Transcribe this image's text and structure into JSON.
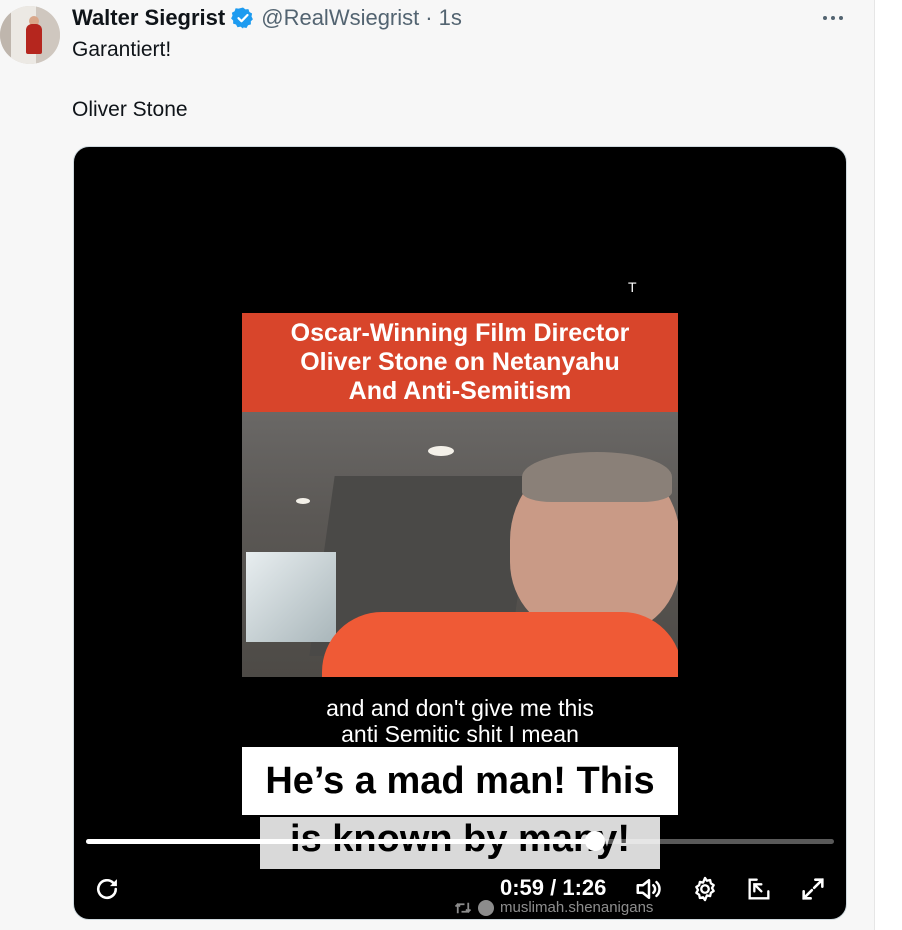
{
  "tweet": {
    "author_name": "Walter Siegrist",
    "handle": "@RealWsiegrist",
    "separator": "·",
    "time": "1s",
    "text_line1": "Garantiert!",
    "text_line2": "Oliver Stone"
  },
  "media": {
    "corner_mark": "T",
    "banner_lines": [
      "Oscar-Winning Film Director",
      "Oliver Stone on Netanyahu",
      "And Anti-Semitism"
    ],
    "caption_lines": [
      "and and don't give me this",
      "anti Semitic shit I mean"
    ],
    "overlay_line1": "He’s a mad man! This",
    "overlay_line2": "is known by many!",
    "watermark": "muslimah.shenanigans"
  },
  "player": {
    "current_time": "0:59",
    "duration": "1:26",
    "time_display": "0:59 / 1:26",
    "progress_fraction": 0.68
  },
  "icons": {
    "verified": "verified-badge-icon",
    "more": "more-options-icon",
    "replay": "replay-icon",
    "volume": "volume-icon",
    "settings": "settings-gear-icon",
    "pip": "picture-in-picture-icon",
    "fullscreen": "fullscreen-icon"
  },
  "colors": {
    "verified_blue": "#1d9bf0",
    "banner_red": "#d8452b",
    "text_primary": "#0f1419",
    "text_secondary": "#536471"
  }
}
